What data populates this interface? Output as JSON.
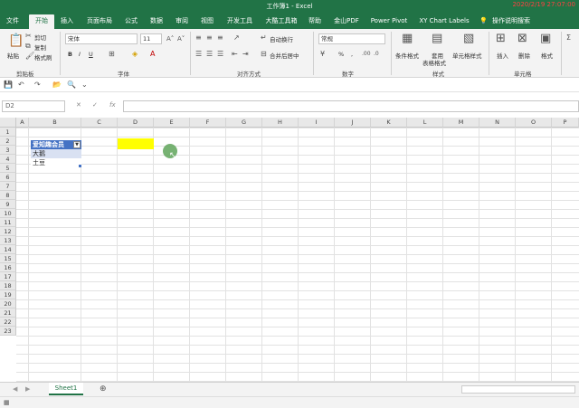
{
  "window": {
    "title": "工作簿1  -  Excel",
    "timestamp": "2020/2/19 27:07:00",
    "accent": "#217346"
  },
  "tabs": [
    "文件",
    "开始",
    "插入",
    "页面布局",
    "公式",
    "数据",
    "审阅",
    "视图",
    "开发工具",
    "大酷工具箱",
    "帮助",
    "金山PDF",
    "Power Pivot",
    "XY Chart Labels",
    "操作说明搜索"
  ],
  "active_tab": "开始",
  "ribbon": {
    "clipboard": {
      "paste": "粘贴",
      "cut": "剪切",
      "copy": "复制",
      "format_painter": "格式刷",
      "group": "剪贴板"
    },
    "font": {
      "name": "宋体",
      "size": "11",
      "bold": "B",
      "italic": "I",
      "underline": "U",
      "group": "字体"
    },
    "alignment": {
      "wrap": "自动换行",
      "merge": "合并后居中",
      "group": "对齐方式"
    },
    "number": {
      "format": "常规",
      "percent": "%",
      "comma": ",",
      "group": "数字"
    },
    "styles": {
      "conditional": "条件格式",
      "table_line1": "套用",
      "table_line2": "表格格式",
      "cell_styles": "单元格样式",
      "group": "样式"
    },
    "cells": {
      "insert": "插入",
      "delete": "删除",
      "format": "格式",
      "group": "单元格"
    }
  },
  "formula_bar": {
    "name_box": "D2",
    "fx": "fx",
    "value": ""
  },
  "grid": {
    "columns": [
      "A",
      "B",
      "C",
      "D",
      "E",
      "F",
      "G",
      "H",
      "I",
      "J",
      "K",
      "L",
      "M",
      "N",
      "O",
      "P"
    ],
    "rows": [
      "1",
      "2",
      "3",
      "4",
      "5",
      "6",
      "7",
      "8",
      "9",
      "10",
      "11",
      "12",
      "13",
      "14",
      "15",
      "16",
      "17",
      "18",
      "19",
      "20",
      "21",
      "22",
      "23"
    ],
    "header_cell": "爱知趣会员",
    "items": [
      "大鹅",
      "土豆"
    ],
    "highlight_color": "#ffff00",
    "header_fill": "#4472c4",
    "row_fill": "#d9e1f2"
  },
  "sheets": [
    "Sheet1"
  ],
  "status": {
    "add_sheet": "⊕"
  }
}
